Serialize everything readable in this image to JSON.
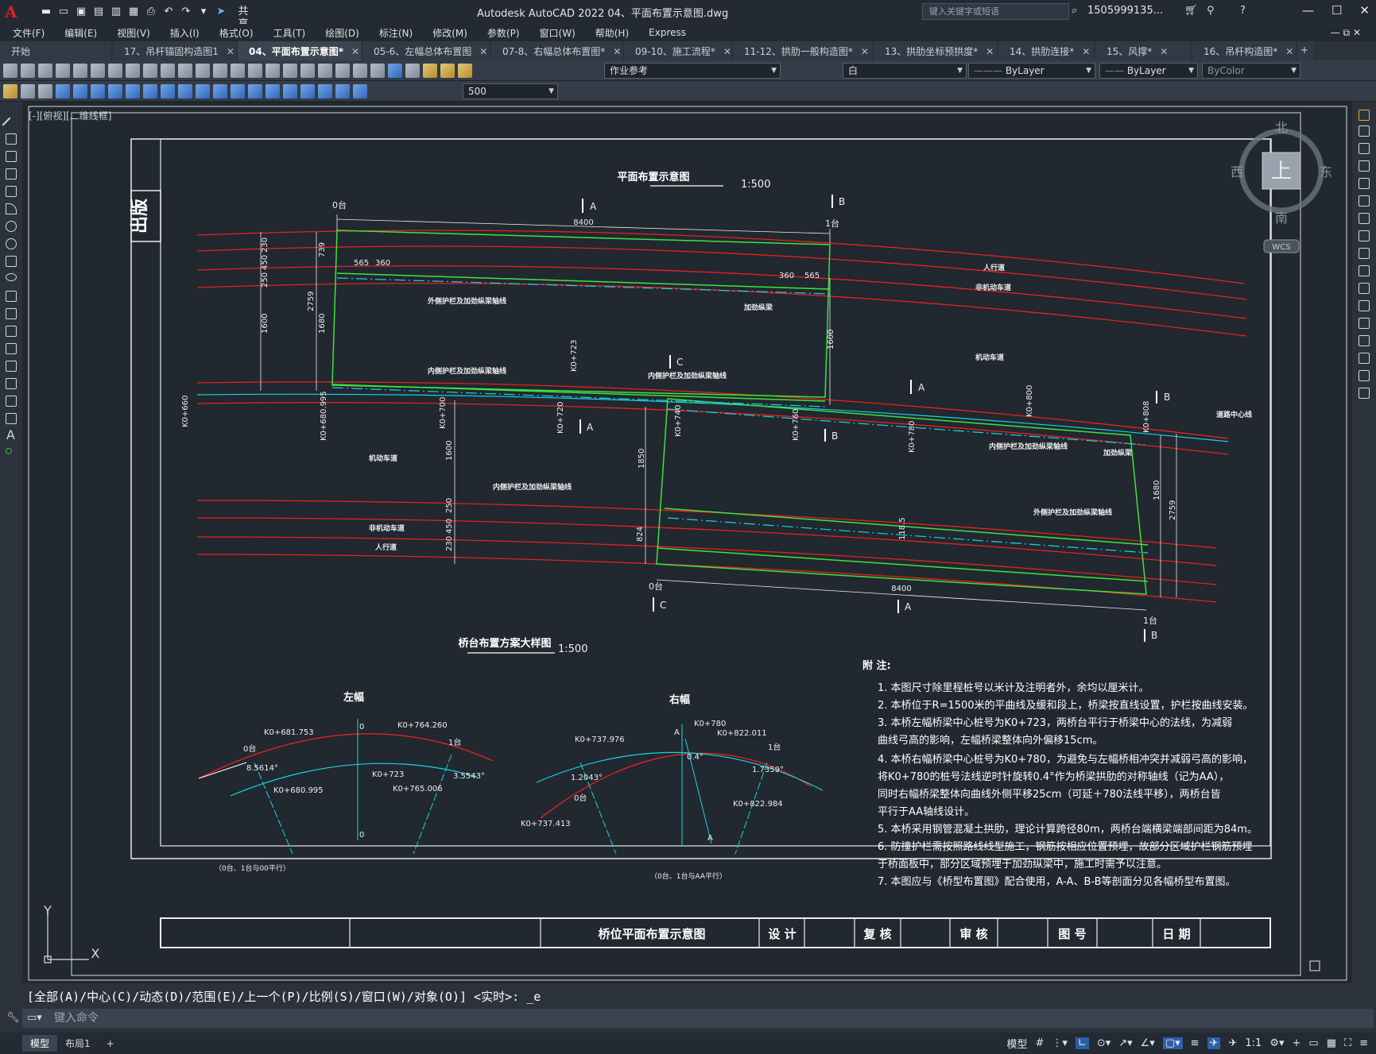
{
  "app": {
    "title": "Autodesk AutoCAD 2022    04、平面布置示意图.dwg",
    "search_placeholder": "键入关键字或短语",
    "user": "1505999135...",
    "share": "共享",
    "accent": "#e02020"
  },
  "menu": [
    "文件(F)",
    "编辑(E)",
    "视图(V)",
    "插入(I)",
    "格式(O)",
    "工具(T)",
    "绘图(D)",
    "标注(N)",
    "修改(M)",
    "参数(P)",
    "窗口(W)",
    "帮助(H)",
    "Express"
  ],
  "tabs": [
    {
      "label": "开始",
      "active": false
    },
    {
      "label": "17、吊杆锚固构造图1",
      "active": false
    },
    {
      "label": "04、平面布置示意图*",
      "active": true
    },
    {
      "label": "05-6、左幅总体布置图",
      "active": false
    },
    {
      "label": "07-8、右幅总体布置图*",
      "active": false
    },
    {
      "label": "09-10、施工流程*",
      "active": false
    },
    {
      "label": "11-12、拱肋一般构造图*",
      "active": false
    },
    {
      "label": "13、拱肋坐标预拱度*",
      "active": false
    },
    {
      "label": "14、拱肋连接*",
      "active": false
    },
    {
      "label": "15、风撑*",
      "active": false
    },
    {
      "label": "16、吊杆构造图*",
      "active": false
    }
  ],
  "toolbar": {
    "layer": "作业参考",
    "color": "白",
    "linetype": "ByLayer",
    "lineweight": "ByLayer",
    "plotstyle": "ByColor",
    "scale": "500"
  },
  "viewport": {
    "label": "[-][俯视][二维线框]",
    "compass": {
      "n": "北",
      "s": "南",
      "e": "东",
      "w": "西",
      "center": "上",
      "wcs": "WCS"
    }
  },
  "drawing": {
    "stamp": "出版",
    "main_title": "平面布置示意图",
    "main_scale": "1:500",
    "detail_title": "桥台布置方案大样图",
    "detail_scale": "1:500",
    "left_label": "左幅",
    "right_label": "右幅",
    "left_note": "（0台、1台与00平行）",
    "right_note": "（0台、1台与AA平行）",
    "dims": {
      "d8400_top": "8400",
      "d8400_bot": "8400",
      "d565": "565",
      "d360": "360",
      "d360b": "360",
      "d565b": "565",
      "d2759": "2759",
      "d1680": "1680",
      "d1600": "1600",
      "d1600b": "1600",
      "d1850": "1850",
      "d1680b": "1680",
      "d2759b": "2759",
      "d824": "824",
      "d250": "250",
      "d450": "450",
      "d230": "230",
      "d739": "739",
      "d1185": "118.5"
    },
    "stations": {
      "s660": "K0+660",
      "s680": "K0+680.995",
      "s700": "K0+700",
      "s720": "K0+720",
      "s723": "K0+723",
      "s740": "K0+740",
      "s760": "K0+760",
      "s780": "K0+780",
      "s800": "K0+800",
      "s808": "K0+808"
    },
    "labels": {
      "ren1": "人行道",
      "fei1": "非机动车道",
      "ji1": "机动车道",
      "ji2": "机动车道",
      "fei2": "非机动车道",
      "ren2": "人行道",
      "road_center": "道路中心线",
      "outer_rail": "外侧护栏及加劲纵梁轴线",
      "inner_rail": "内侧护栏及加劲纵梁轴线",
      "jia1": "加劲纵梁",
      "jia2": "加劲纵梁",
      "inner2": "内侧护栏及加劲纵梁轴线",
      "outer2": "外侧护栏及加劲纵梁轴线",
      "pier0": "0台",
      "pier1": "1台",
      "pier0b": "0台",
      "pier1b": "1台",
      "secA": "A",
      "secB": "B",
      "secC": "C"
    },
    "detail_left": {
      "k1": "K0+681.753",
      "k2": "K0+764.260",
      "k3": "K0+723",
      "k4": "K0+680.995",
      "k5": "K0+765.006",
      "a1": "8.5614°",
      "a2": "3.5543°",
      "zero": "0",
      "zero2": "0"
    },
    "detail_right": {
      "k1": "K0+737.976",
      "k2": "K0+780",
      "k3": "K0+822.011",
      "k4": "K0+737.413",
      "k5": "K0+822.984",
      "a1": "1.2043°",
      "a2": "1.7359°",
      "a3": "0.4°",
      "A": "A"
    },
    "notes_title": "附  注:",
    "notes": [
      "1. 本图尺寸除里程桩号以米计及注明者外，余均以厘米计。",
      "2. 本桥位于R=1500米的平曲线及缓和段上，桥梁按直线设置，护栏按曲线安装。",
      "3. 本桥左幅桥梁中心桩号为K0+723，两桥台平行于桥梁中心的法线，为减弱",
      "    曲线弓高的影响，左幅桥梁整体向外偏移15cm。",
      "4. 本桥右幅桥梁中心桩号为K0+780，为避免与左幅桥相冲突并减弱弓高的影响，",
      "    将K0+780的桩号法线逆时针旋转0.4°作为桥梁拱肋的对称轴线（记为AA），",
      "    同时右幅桥梁整体向曲线外侧平移25cm（可延＋780法线平移），两桥台皆",
      "    平行于AA轴线设计。",
      "5. 本桥采用钢管混凝土拱肋，理论计算跨径80m，两桥台端横梁端部间距为84m。",
      "6. 防撞护栏需按照路线线型施工，钢筋按相应位置预埋，故部分区域护栏钢筋预埋",
      "    于桥面板中，部分区域预埋于加劲纵梁中，施工时需予以注意。",
      "7. 本图应与《桥型布置图》配合使用，A-A、B-B等剖面分见各幅桥型布置图。"
    ],
    "titleblock": {
      "name": "桥位平面布置示意图",
      "design": "设 计",
      "check": "复 核",
      "review": "审 核",
      "drawing_no": "图 号",
      "date": "日 期"
    }
  },
  "command": {
    "history": "[全部(A)/中心(C)/动态(D)/范围(E)/上一个(P)/比例(S)/窗口(W)/对象(O)] <实时>: _e",
    "placeholder": "键入命令"
  },
  "status": {
    "model_tab": "模型",
    "layout_tab": "布局1",
    "model_label": "模型",
    "scale": "1:1"
  }
}
